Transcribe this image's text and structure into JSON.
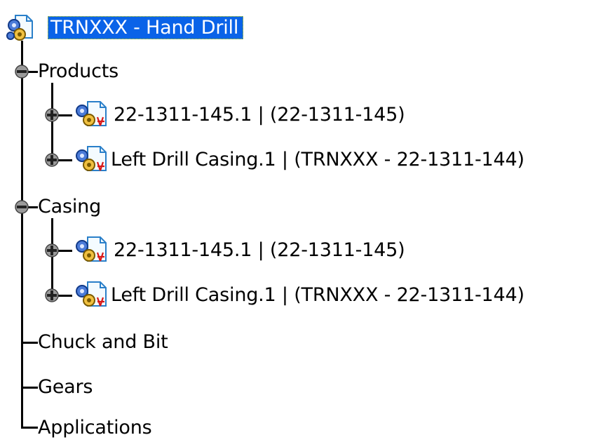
{
  "tree": {
    "root": {
      "label": "TRNXXX - Hand Drill",
      "icon": "product-root-icon"
    },
    "nodes": [
      {
        "label": "Products",
        "expanded": true,
        "children": [
          {
            "label": "22-1311-145.1 | (22-1311-145)",
            "icon": "part-document-icon",
            "expanded": false
          },
          {
            "label": "Left Drill Casing.1 | (TRNXXX - 22-1311-144)",
            "icon": "part-document-icon",
            "expanded": false
          }
        ]
      },
      {
        "label": "Casing",
        "expanded": true,
        "children": [
          {
            "label": "22-1311-145.1 | (22-1311-145)",
            "icon": "part-document-icon",
            "expanded": false
          },
          {
            "label": "Left Drill Casing.1 | (TRNXXX - 22-1311-144)",
            "icon": "part-document-icon",
            "expanded": false
          }
        ]
      },
      {
        "label": "Chuck and Bit"
      },
      {
        "label": "Gears"
      },
      {
        "label": "Applications"
      }
    ]
  },
  "colors": {
    "selection": "#0a63e8",
    "selection_text": "#ffffff",
    "lines": "#000000"
  }
}
